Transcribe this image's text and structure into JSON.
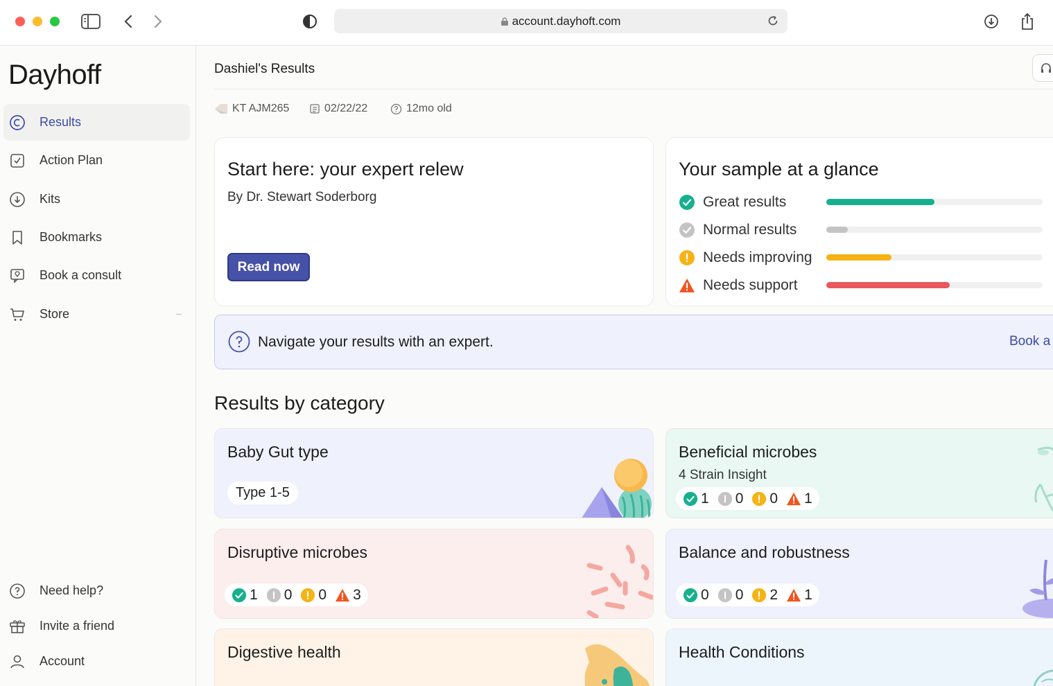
{
  "browser": {
    "url": "account.dayhoft.com"
  },
  "sidebar": {
    "logo": "Dayhoff",
    "items": [
      {
        "label": "Results",
        "icon": "copyright-circle-icon",
        "active": true
      },
      {
        "label": "Action Plan",
        "icon": "action-plan-icon"
      },
      {
        "label": "Kits",
        "icon": "download-circle-icon"
      },
      {
        "label": "Bookmarks",
        "icon": "bookmark-icon"
      },
      {
        "label": "Book a consult",
        "icon": "consult-icon"
      },
      {
        "label": "Store",
        "icon": "cart-icon"
      }
    ],
    "bottom_items": [
      {
        "label": "Need help?",
        "icon": "help-circle-icon"
      },
      {
        "label": "Invite a friend",
        "icon": "gift-icon"
      },
      {
        "label": "Account",
        "icon": "user-icon"
      }
    ]
  },
  "main": {
    "title": "Dashiel's Results",
    "meta": {
      "kit": "KT AJM265",
      "date": "02/22/22",
      "age": "12mo old"
    },
    "review_card": {
      "title": "Start here: your expert relew",
      "byline": "By Dr. Stewart Soderborg",
      "button": "Read now"
    },
    "glance": {
      "title": "Your sample at a glance",
      "rows": [
        {
          "label": "Great results",
          "level": 0.5,
          "color": "#16b08e"
        },
        {
          "label": "Normal results",
          "level": 0.1,
          "color": "#c4c4c4"
        },
        {
          "label": "Needs improving",
          "level": 0.3,
          "color": "#f5b316"
        },
        {
          "label": "Needs support",
          "level": 0.57,
          "color": "#e9585c"
        }
      ]
    },
    "expert_banner": {
      "text": "Navigate your results with an expert.",
      "link": "Book a"
    },
    "section_title": "Results by category",
    "categories": {
      "gut_type": {
        "title": "Baby Gut type",
        "pill": "Type 1-5"
      },
      "beneficial": {
        "title": "Beneficial microbes",
        "sub": "4 Strain Insight",
        "counts": [
          "1",
          "0",
          "0",
          "1"
        ]
      },
      "disruptive": {
        "title": "Disruptive microbes",
        "counts": [
          "1",
          "0",
          "0",
          "3"
        ]
      },
      "balance": {
        "title": "Balance and robustness",
        "counts": [
          "0",
          "0",
          "2",
          "1"
        ]
      },
      "digestive": {
        "title": "Digestive health"
      },
      "conditions": {
        "title": "Health Conditions"
      }
    }
  },
  "colors": {
    "accent": "#4651a8",
    "great": "#16b08e",
    "normal": "#c4c4c4",
    "improving": "#f5b316",
    "support": "#f0561f"
  }
}
